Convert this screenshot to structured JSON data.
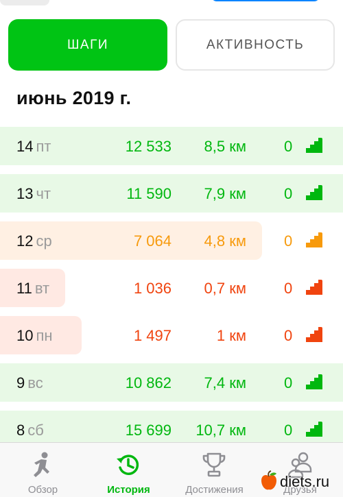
{
  "tabs": {
    "steps_label": "ШАГИ",
    "activity_label": "АКТИВНОСТЬ"
  },
  "month_title": "июнь 2019 г.",
  "colors": {
    "green": "#00b70f",
    "orange": "#f79a0c",
    "red": "#f0440f",
    "accent": "#00c414"
  },
  "days": [
    {
      "day": "14",
      "weekday": "пт",
      "steps": "12 533",
      "distance": "8,5 км",
      "value": "0",
      "level": "high",
      "bar_fraction": 1.0
    },
    {
      "day": "13",
      "weekday": "чт",
      "steps": "11 590",
      "distance": "7,9 км",
      "value": "0",
      "level": "high",
      "bar_fraction": 1.0
    },
    {
      "day": "12",
      "weekday": "ср",
      "steps": "7 064",
      "distance": "4,8 км",
      "value": "0",
      "level": "mid",
      "bar_fraction": 0.71
    },
    {
      "day": "11",
      "weekday": "вт",
      "steps": "1 036",
      "distance": "0,7 км",
      "value": "0",
      "level": "low",
      "bar_fraction": 0.1
    },
    {
      "day": "10",
      "weekday": "пн",
      "steps": "1 497",
      "distance": "1 км",
      "value": "0",
      "level": "low",
      "bar_fraction": 0.15
    },
    {
      "day": "9",
      "weekday": "вс",
      "steps": "10 862",
      "distance": "7,4 км",
      "value": "0",
      "level": "high",
      "bar_fraction": 1.0
    },
    {
      "day": "8",
      "weekday": "сб",
      "steps": "15 699",
      "distance": "10,7 км",
      "value": "0",
      "level": "high",
      "bar_fraction": 1.0
    }
  ],
  "nav": {
    "overview": "Обзор",
    "history": "История",
    "achievements": "Достижения",
    "friends": "Друзья"
  },
  "watermark": "diets.ru"
}
